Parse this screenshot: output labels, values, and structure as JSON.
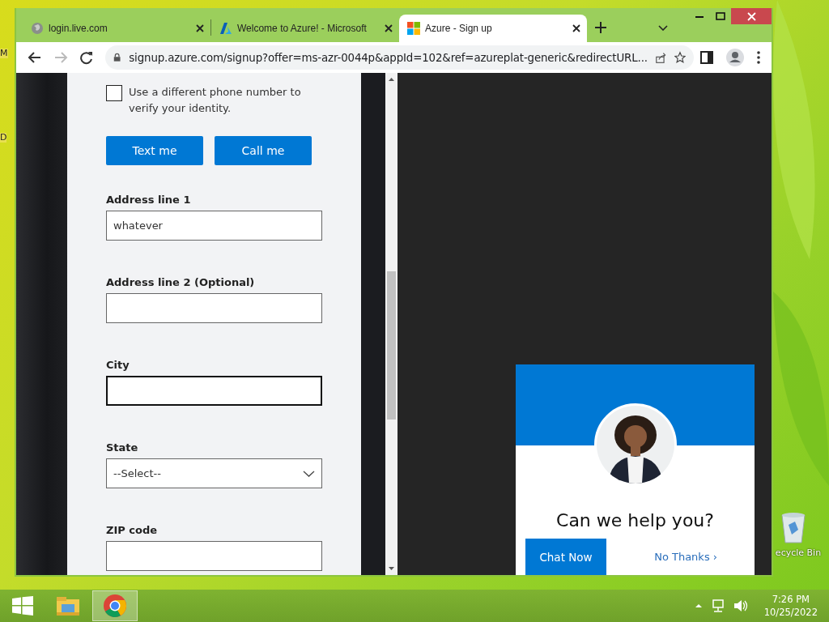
{
  "desktop": {
    "icon_labels": [
      {
        "label": "M",
        "kind": "fragment"
      },
      {
        "label": "D",
        "kind": "fragment"
      },
      {
        "label": "ecycle Bin",
        "kind": "recycle-bin"
      }
    ]
  },
  "browser": {
    "tabs": [
      {
        "title": "login.live.com",
        "kind": "globe",
        "selected": false
      },
      {
        "title": "Welcome to Azure! - Microsoft",
        "kind": "azure",
        "selected": false
      },
      {
        "title": "Azure - Sign up",
        "kind": "windows",
        "selected": true
      }
    ],
    "address": "signup.azure.com/signup?offer=ms-azr-0044p&appId=102&ref=azureplat-generic&redirectURL..."
  },
  "form": {
    "checkbox": {
      "label": "Use a different phone number to verify your identity.",
      "checked": false
    },
    "buttons": [
      "Text me",
      "Call me"
    ],
    "fields": [
      {
        "label": "Address line 1",
        "kind": "text",
        "value": "whatever",
        "focused": false
      },
      {
        "label": "Address line 2 (Optional)",
        "kind": "text",
        "focused": false
      },
      {
        "label": "City",
        "kind": "text",
        "focused": true
      },
      {
        "label": "State",
        "kind": "select",
        "value": "--Select--",
        "focused": false
      },
      {
        "label": "ZIP code",
        "kind": "text",
        "focused": false
      }
    ]
  },
  "chat": {
    "heading": "Can we help you?",
    "primary": "Chat Now",
    "secondary": "No Thanks ›"
  },
  "taskbar": {
    "time": "7:26 PM",
    "date": "10/25/2022"
  }
}
